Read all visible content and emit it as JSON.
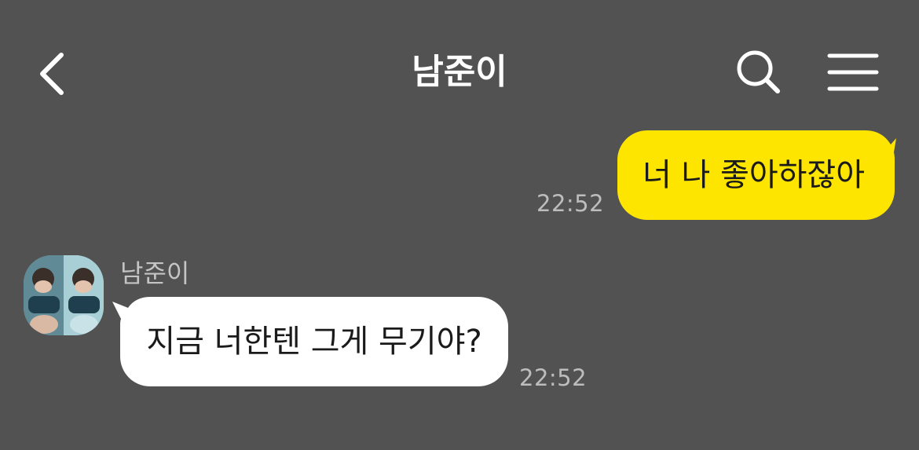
{
  "header": {
    "title": "남준이",
    "back_icon": "chevron-left-icon",
    "search_icon": "search-icon",
    "menu_icon": "hamburger-menu-icon"
  },
  "messages": [
    {
      "direction": "sent",
      "text": "너 나 좋아하잖아",
      "time": "22:52",
      "bubble_color": "#FEE500"
    },
    {
      "direction": "received",
      "sender": "남준이",
      "text": "지금 너한텐 그게 무기야?",
      "time": "22:52",
      "bubble_color": "#FFFFFF"
    }
  ],
  "colors": {
    "background": "#525252",
    "header_text": "#FFFFFF",
    "timestamp": "#BDBDBD",
    "sender_name": "#C4C4C4"
  }
}
